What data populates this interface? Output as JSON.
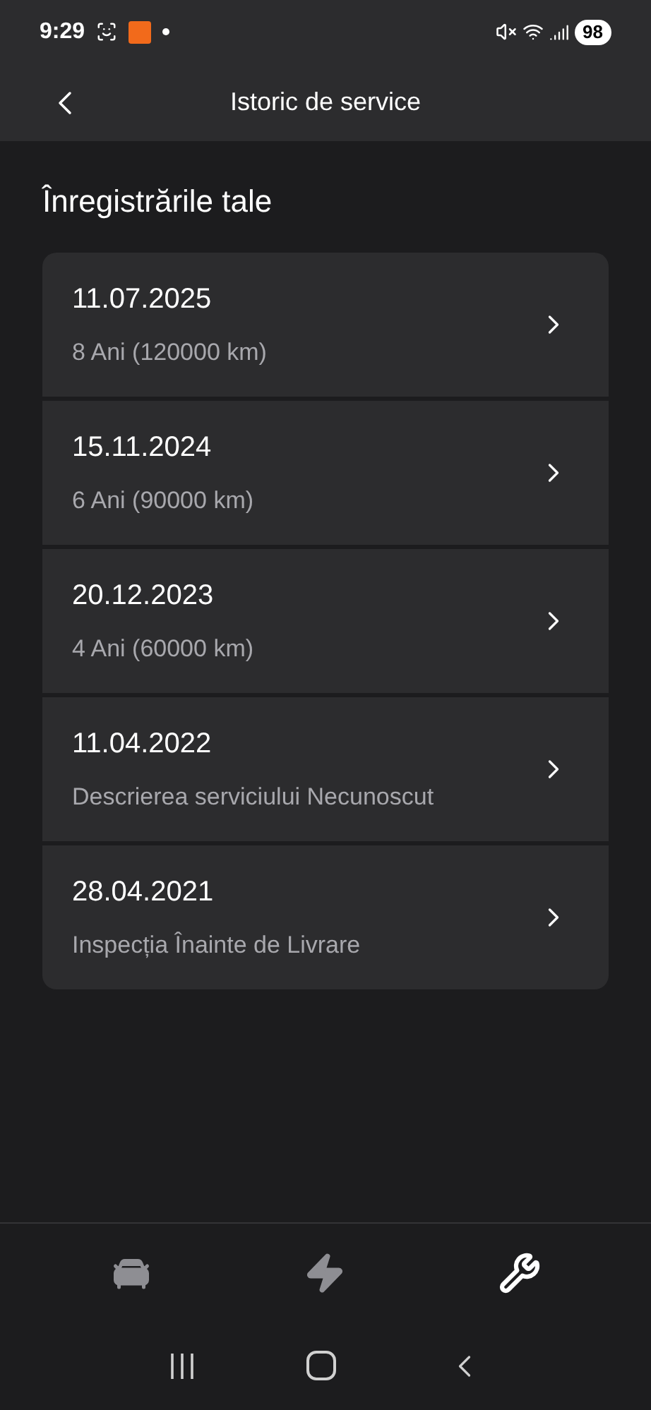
{
  "status_bar": {
    "time": "9:29",
    "battery": "98"
  },
  "header": {
    "title": "Istoric de service"
  },
  "section_title": "Înregistrările tale",
  "records": [
    {
      "date": "11.07.2025",
      "description": "8 Ani (120000 km)"
    },
    {
      "date": "15.11.2024",
      "description": "6 Ani (90000 km)"
    },
    {
      "date": "20.12.2023",
      "description": "4 Ani (60000 km)"
    },
    {
      "date": "11.04.2022",
      "description": "Descrierea serviciului Necunoscut"
    },
    {
      "date": "28.04.2021",
      "description": "Inspecția Înainte de Livrare"
    }
  ],
  "bottom_nav": [
    {
      "kind": "car",
      "selected": false
    },
    {
      "kind": "charging",
      "selected": false
    },
    {
      "kind": "service",
      "selected": true
    }
  ]
}
